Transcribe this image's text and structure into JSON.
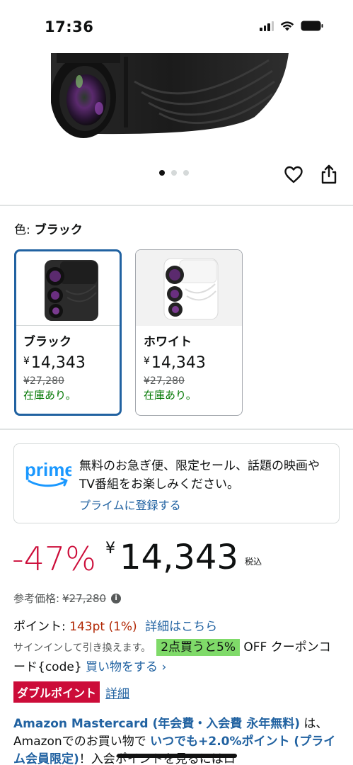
{
  "status_bar": {
    "time": "17:36"
  },
  "gallery": {
    "dot_count": 3,
    "active_dot": 0
  },
  "color": {
    "label": "色:",
    "selected": "ブラック",
    "options": [
      {
        "name": "ブラック",
        "yen": "¥",
        "price": "14,343",
        "list_price": "¥27,280",
        "stock": "在庫あり。"
      },
      {
        "name": "ホワイト",
        "yen": "¥",
        "price": "14,343",
        "list_price": "¥27,280",
        "stock": "在庫あり。"
      }
    ]
  },
  "prime": {
    "logo_text": "prime",
    "text": "無料のお急ぎ便、限定セール、話題の映画やTV番組をお楽しみください。",
    "link": "プライムに登録する"
  },
  "price": {
    "discount": "-47%",
    "yen": "¥",
    "amount": "14,343",
    "tax": "税込",
    "ref_label": "参考価格:",
    "ref_value": "¥27,280"
  },
  "points": {
    "label": "ポイント:",
    "value": "143pt",
    "percent": "(1%)",
    "link": "詳細はこちら"
  },
  "coupon": {
    "signin": "サインインして引き換えます。",
    "badge": "2点買うと5%",
    "text": "OFF クーポンコード{code}",
    "link": "買い物をする ›"
  },
  "double_point": {
    "badge": "ダブルポイント",
    "link": "詳細"
  },
  "mastercard": {
    "title": "Amazon Mastercard (年会費・入会費 永年無料)",
    "text1": "は、Amazonでのお買い物で",
    "bold": "いつでも+2.0%ポイント (プライム会員限定)",
    "text2": "！入会ポイントを見るにはロ"
  },
  "colors": {
    "accent_blue": "#2162a1",
    "deal_red": "#cc0c39",
    "stock_green": "#007600"
  }
}
